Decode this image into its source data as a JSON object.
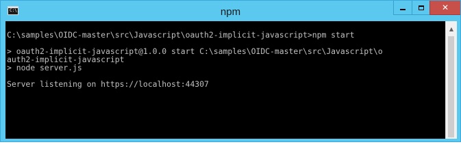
{
  "window": {
    "title": "npm",
    "icon": "console-window-icon",
    "icon_glyph": "C:\\.",
    "controls": {
      "minimize": "minimize-icon",
      "maximize": "maximize-icon",
      "close": "✕"
    }
  },
  "console": {
    "lines": [
      "C:\\samples\\OIDC-master\\src\\Javascript\\oauth2-implicit-javascript>npm start",
      "",
      "> oauth2-implicit-javascript@1.0.0 start C:\\samples\\OIDC-master\\src\\Javascript\\o",
      "auth2-implicit-javascript",
      "> node server.js",
      "",
      "Server listening on https://localhost:44307"
    ]
  },
  "scrollbar": {
    "up_arrow": "▲"
  },
  "colors": {
    "title_bar": "#5bc8ef",
    "close_button": "#c7504b",
    "console_background": "#000000",
    "console_text": "#c0c0c0"
  }
}
